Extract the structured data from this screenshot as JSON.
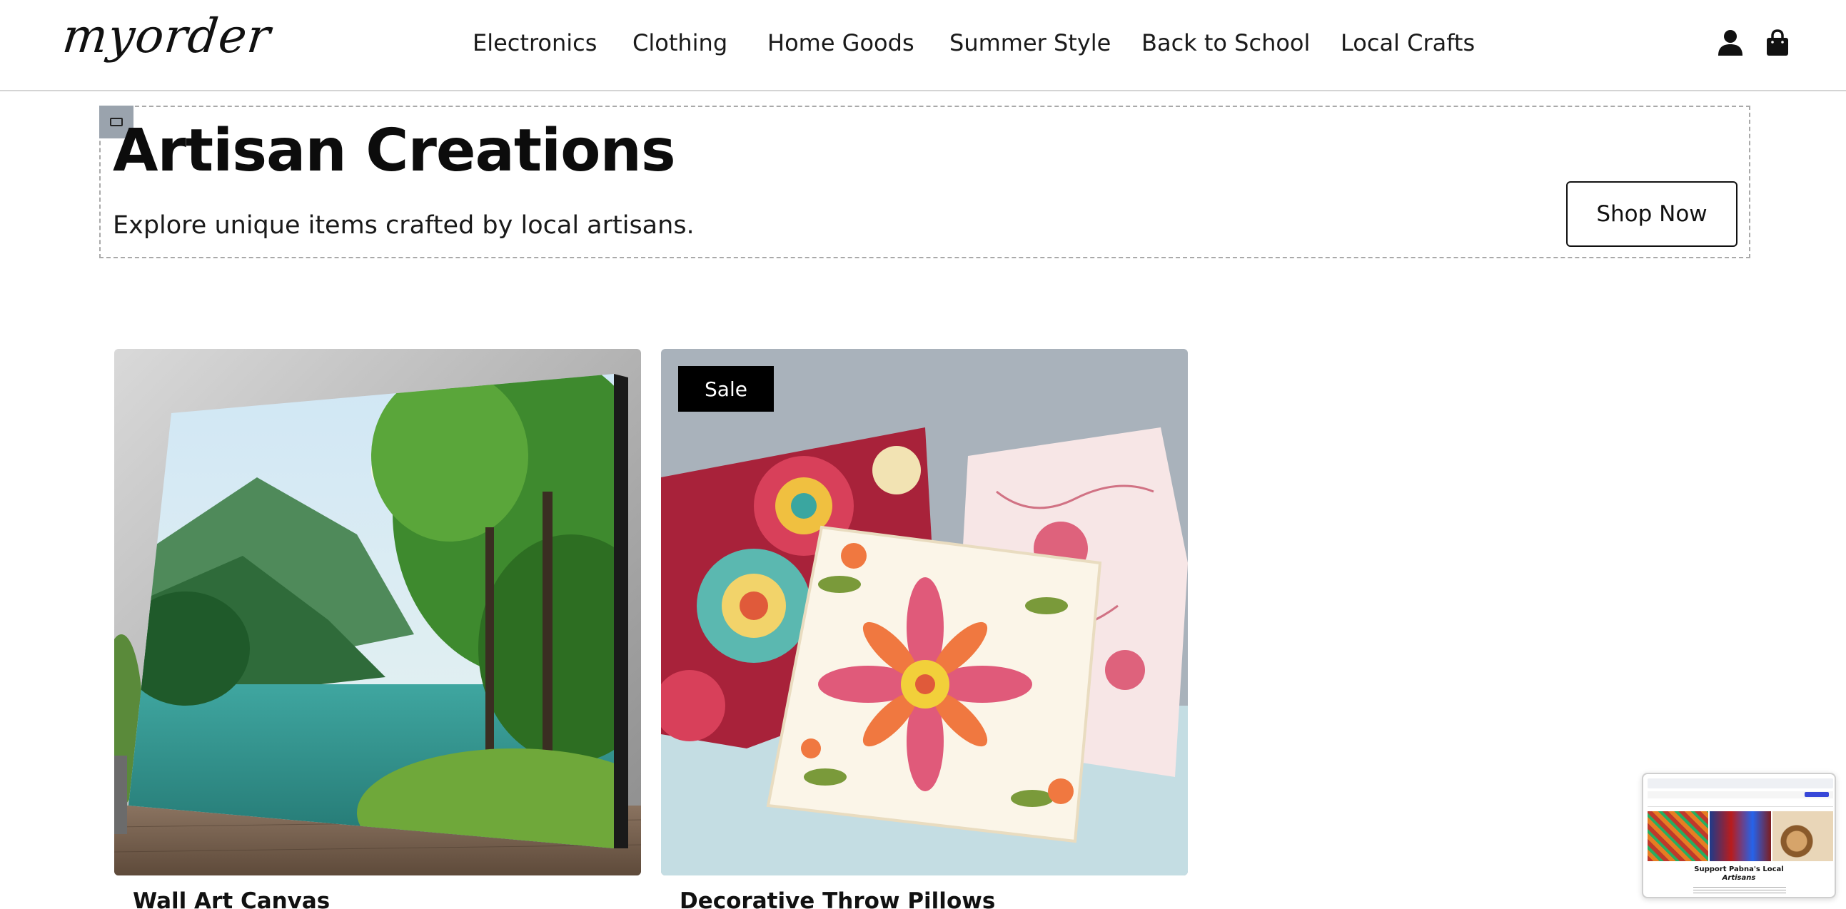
{
  "header": {
    "logo": "myorder",
    "nav": [
      "Electronics",
      "Clothing",
      "Home Goods",
      "Summer Style",
      "Back to School",
      "Local Crafts"
    ],
    "icons": [
      "user-icon",
      "shopping-bag-icon"
    ]
  },
  "hero": {
    "title": "Artisan Creations",
    "subtitle": "Explore unique items crafted by local artisans.",
    "cta": "Shop Now"
  },
  "products": [
    {
      "title": "Wall Art Canvas",
      "badge": ""
    },
    {
      "title": "Decorative Throw Pillows",
      "badge": "Sale"
    }
  ],
  "preview": {
    "title_line1": "Support Pabna's Local",
    "title_line2": "Artisans"
  },
  "colors": {
    "text": "#111111",
    "border": "#d4d4d4",
    "badge_bg": "#000000",
    "badge_text": "#ffffff"
  }
}
